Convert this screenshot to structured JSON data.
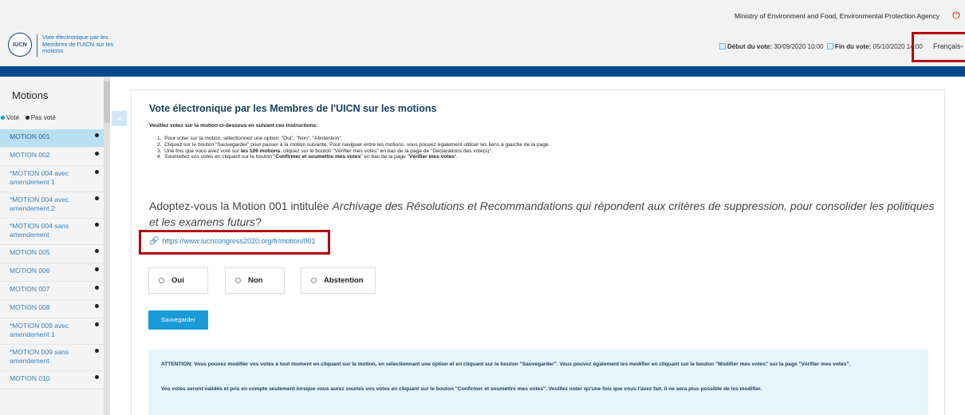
{
  "topbar": {
    "ministry": "Ministry of Environment and Food, Environmental Protection Agency",
    "power_icon": "power-icon"
  },
  "header": {
    "logo_text": "IUCN",
    "subtitle": "Vote électronique par les Membres de l'UICN sur les motions",
    "vote_start_label": "Début du vote:",
    "vote_start": "30/09/2020 10:00",
    "vote_end_label": "Fin du vote:",
    "vote_end": "05/10/2020 14:00",
    "language": "Français"
  },
  "colors": {
    "brand_blue": "#004a8c",
    "accent": "#1a9bd7",
    "highlight_red": "#b30010",
    "active_item": "#b9dff2"
  },
  "sidebar": {
    "title": "Motions",
    "legend_voted": "Voté",
    "legend_not_voted": "Pas voté",
    "collapse_label": "«",
    "items": [
      {
        "label": "MOTION 001",
        "active": true
      },
      {
        "label": "MOTION 002"
      },
      {
        "label": "*MOTION 004 avec amendement 1"
      },
      {
        "label": "*MOTION 004 avec amendement 2"
      },
      {
        "label": "*MOTION 004 sans amendement"
      },
      {
        "label": "MOTION 005"
      },
      {
        "label": "MOTION 006"
      },
      {
        "label": "MOTION 007"
      },
      {
        "label": "MOTION 008"
      },
      {
        "label": "*MOTION 009 avec amendement 1"
      },
      {
        "label": "*MOTION 009 sans amendement"
      },
      {
        "label": "MOTION 010"
      }
    ]
  },
  "main": {
    "title": "Vote électronique par les Membres de l'UICN sur les motions",
    "instructions_intro": "Veuillez votez sur la motion ci-dessous en suivant ces instructions:",
    "instructions": [
      {
        "pre": "Pour voter sur la motion, sélectionnez une option: \"Oui\", \"Non\", \"Abstention\".",
        "bold": "",
        "post": ""
      },
      {
        "pre": "Cliquez sur le bouton \"Sauvegarder\" pour passer à la motion suivante. Pour naviguer entre les motions, vous pouvez également utiliser les liens à gauche de la page.",
        "bold": "",
        "post": ""
      },
      {
        "pre": "Une fois que vous avez voté sur ",
        "bold": "les 109 motions",
        "post": ", cliquez sur le bouton \"Vérifier mes votes\" en bas de la page de \"Déclarations des vote(s)\"."
      },
      {
        "pre": "Soumettez vos votes en cliquant sur le bouton \"",
        "bold": "Confirmer et soumettre mes votes",
        "post": "\" en bas de la page \"",
        "bold2": "Vérifier mes votes",
        "post2": "\"."
      }
    ],
    "question_prefix": "Adoptez-vous la Motion 001 intitulée ",
    "question_title": "Archivage des Résolutions et Recommandations qui répondent aux critères de suppression, pour consolider les politiques et les examens futurs",
    "question_suffix": "?",
    "motion_link": "https://www.iucncongress2020.org/fr/motion/001",
    "options": {
      "yes": "Oui",
      "no": "Non",
      "abstain": "Abstention"
    },
    "save_label": "Sauvegarder",
    "alert_p1": "ATTENTION: Vous pouvez modifier vos votes à tout moment en cliquant sur la motion, en sélectionnant une option et en cliquant sur le bouton \"Sauvegarder\".  Vous pouvez également les modifier en cliquant sur le bouton \"Modifier mes votes\" sur la page \"Vérifier mes votes\".",
    "alert_p2": "Vos votes seront validés et pris en compte seulement lorsque vous aurez soumis vos votes en cliquant sur le bouton \"Confirmer et soumettre mes votes\". Veuillez noter qu'une fois que vous l'avez fait, il ne sera plus possible de les modifier."
  }
}
